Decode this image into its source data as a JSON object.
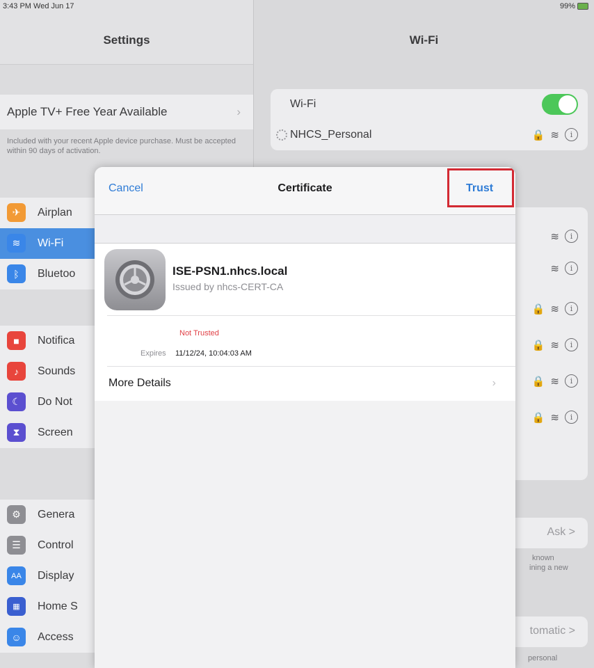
{
  "status": {
    "time": "3:43 PM  Wed Jun 17",
    "battery": "99%"
  },
  "settings": {
    "title": "Settings",
    "promo_title": "Apple TV+ Free Year Available",
    "promo_note": "Included with your recent Apple device purchase. Must be accepted within 90 days of activation.",
    "group1": [
      {
        "label": "Airplan",
        "color": "#f29a35"
      },
      {
        "label": "Wi-Fi",
        "color": "#3a86e8"
      },
      {
        "label": "Bluetoo",
        "color": "#3a86e8"
      }
    ],
    "group2": [
      {
        "label": "Notifica",
        "color": "#e8453c"
      },
      {
        "label": "Sounds",
        "color": "#e8453c"
      },
      {
        "label": "Do Not",
        "color": "#5b4fd0"
      },
      {
        "label": "Screen",
        "color": "#5b4fd0"
      }
    ],
    "group3": [
      {
        "label": "Genera",
        "color": "#8e8e93"
      },
      {
        "label": "Control",
        "color": "#8e8e93"
      },
      {
        "label": "Display",
        "color": "#3a86e8"
      },
      {
        "label": "Home S",
        "color": "#3a5fd0"
      },
      {
        "label": "Access",
        "color": "#3a86e8"
      }
    ]
  },
  "wifi": {
    "title": "Wi-Fi",
    "toggle_label": "Wi-Fi",
    "network": "NHCS_Personal",
    "ask_value": "Ask >",
    "ask_note1": "known",
    "ask_note2": "ining a new",
    "auto_value": "tomatic >",
    "auto_note": "personal"
  },
  "modal": {
    "cancel": "Cancel",
    "title": "Certificate",
    "trust": "Trust",
    "cert_name": "ISE-PSN1.nhcs.local",
    "issuer": "Issued by nhcs-CERT-CA",
    "not_trusted": "Not Trusted",
    "expires_label": "Expires",
    "expires_value": "11/12/24, 10:04:03 AM",
    "more_details": "More Details"
  }
}
